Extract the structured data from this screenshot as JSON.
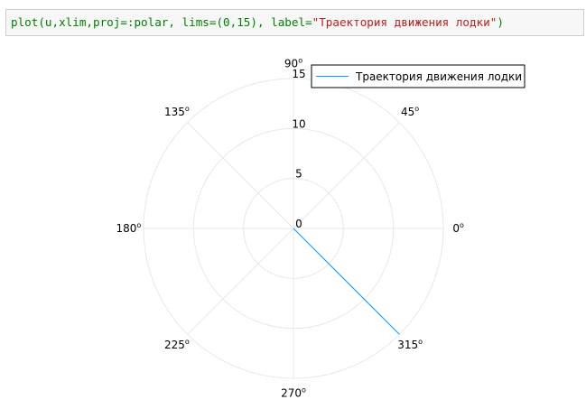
{
  "code": {
    "before_string": "plot(u,xlim,proj=:polar, lims=(0,15), label=",
    "string_literal": "\"Траектория движения лодки\"",
    "after_string": ")"
  },
  "colors": {
    "series": "#009af9",
    "grid": "#e8e8e8"
  },
  "chart_data": {
    "type": "line",
    "projection": "polar",
    "radial_ticks": [
      "0",
      "5",
      "10",
      "15"
    ],
    "radial_tick_values": [
      0,
      5,
      10,
      15
    ],
    "rlim": [
      0,
      15
    ],
    "angle_tick_degrees": [
      0,
      45,
      90,
      135,
      180,
      225,
      270,
      315
    ],
    "angle_tick_labels": [
      {
        "base": "0",
        "sup": "o"
      },
      {
        "base": "45",
        "sup": "o"
      },
      {
        "base": "90",
        "sup": "o"
      },
      {
        "base": "135",
        "sup": "o"
      },
      {
        "base": "180",
        "sup": "o"
      },
      {
        "base": "225",
        "sup": "o"
      },
      {
        "base": "270",
        "sup": "o"
      },
      {
        "base": "315",
        "sup": "o"
      }
    ],
    "grid": true,
    "legend_position": "top-right",
    "series": [
      {
        "name": "Траектория движения лодки",
        "theta_deg": [
          315,
          315
        ],
        "r": [
          0,
          15
        ]
      }
    ]
  }
}
